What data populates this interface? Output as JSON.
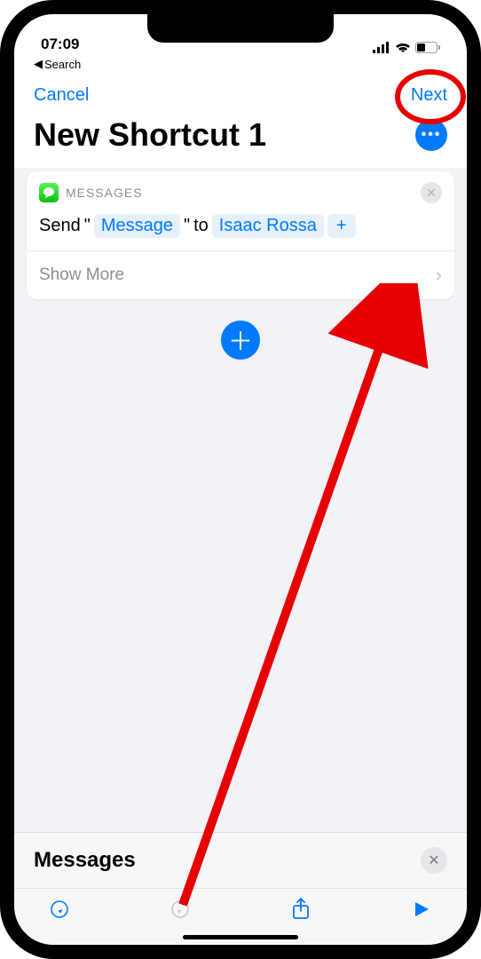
{
  "status": {
    "time": "07:09",
    "breadcrumb": "Search"
  },
  "nav": {
    "cancel": "Cancel",
    "next": "Next"
  },
  "title": "New Shortcut 1",
  "action_card": {
    "app_label": "MESSAGES",
    "prefix": "Send",
    "quote_open": "\"",
    "message_token": "Message",
    "quote_close": "\"",
    "to_text": "to",
    "recipient": "Isaac Rossa",
    "add_glyph": "+",
    "show_more": "Show More"
  },
  "bottom_panel": {
    "title": "Messages"
  }
}
